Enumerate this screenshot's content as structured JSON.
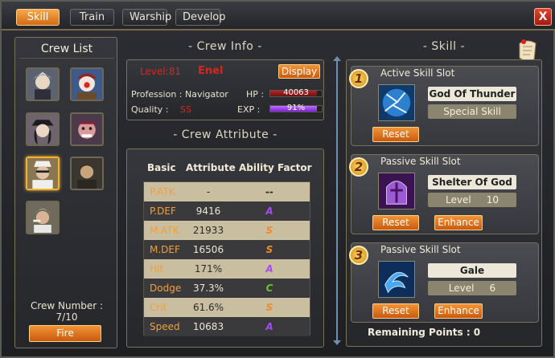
{
  "tabs": [
    "Skill",
    "Train",
    "Warship",
    "Develop"
  ],
  "close_label": "X",
  "crew_list": {
    "title": "Crew List",
    "crew_number_label": "Crew Number :",
    "crew_number_value": "7/10",
    "fire_label": "Fire"
  },
  "crew_info": {
    "title": "- Crew Info -",
    "level": "Level:81",
    "name": "Enel",
    "display_label": "Display",
    "profession": "Profession : Navigator",
    "hp_label": "HP :",
    "hp_value": "40063",
    "quality_label": "Quality :",
    "quality_value": "SS",
    "exp_label": "EXP :",
    "exp_value": "91%",
    "exp_fraction": 0.91,
    "hp_fraction": 0.9
  },
  "crew_attribute": {
    "title": "- Crew Attribute -",
    "headers": [
      "Basic",
      "Attribute",
      "Ability Factor"
    ],
    "rows": [
      {
        "basic": "P.ATK",
        "attribute": "-",
        "factor": "--"
      },
      {
        "basic": "P.DEF",
        "attribute": "9416",
        "factor": "A"
      },
      {
        "basic": "M.ATK",
        "attribute": "21933",
        "factor": "S"
      },
      {
        "basic": "M.DEF",
        "attribute": "16506",
        "factor": "S"
      },
      {
        "basic": "Hit",
        "attribute": "171%",
        "factor": "A"
      },
      {
        "basic": "Dodge",
        "attribute": "37.3%",
        "factor": "C"
      },
      {
        "basic": "Crit",
        "attribute": "61.6%",
        "factor": "S"
      },
      {
        "basic": "Speed",
        "attribute": "10683",
        "factor": "A"
      }
    ]
  },
  "skill": {
    "title": "- Skill -",
    "slots": [
      {
        "number": "1",
        "title": "Active Skill Slot",
        "name": "God Of Thunder",
        "sub": "Special Skill",
        "reset": "Reset"
      },
      {
        "number": "2",
        "title": "Passive Skill Slot",
        "name": "Shelter Of God",
        "sub": "Level     10",
        "reset": "Reset",
        "enhance": "Enhance"
      },
      {
        "number": "3",
        "title": "Passive Skill Slot",
        "name": "Gale",
        "sub": "Level     6",
        "reset": "Reset",
        "enhance": "Enhance"
      }
    ],
    "remaining_points": "Remaining Points : 0"
  },
  "colors": {
    "accent_orange": "#f29436",
    "factor_S": "#f08a2a",
    "factor_A": "#a44cf0",
    "factor_C": "#5ecb2e",
    "hp_bar": "#8f1c1c",
    "exp_bar": "#9b3ff0"
  }
}
